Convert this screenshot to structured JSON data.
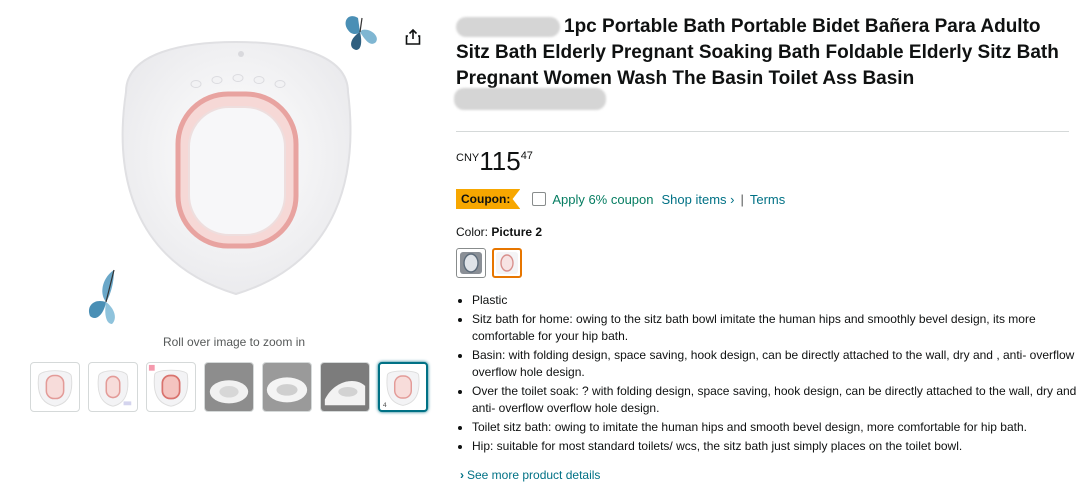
{
  "gallery": {
    "zoom_hint": "Roll over image to zoom in",
    "thumbnails": [
      "white-pink",
      "white-pink-2",
      "white-pink-3",
      "photo-1",
      "photo-2",
      "photo-3",
      "selected"
    ]
  },
  "product": {
    "title": "1pc Portable Bath Portable Bidet Bañera Para Adulto Sitz Bath Elderly Pregnant Soaking Bath Foldable Elderly Sitz Bath Pregnant Women Wash The Basin Toilet Ass Basin",
    "price": {
      "currency": "CNY",
      "whole": "115",
      "fraction": "47"
    },
    "coupon": {
      "badge": "Coupon:",
      "apply": "Apply 6% coupon",
      "shop_items": "Shop items ›",
      "separator": "|",
      "terms": "Terms"
    },
    "color": {
      "label": "Color:",
      "value": "Picture 2"
    },
    "bullets": [
      "Plastic",
      "Sitz bath for home: owing to the sitz bath bowl imitate the human hips and smoothly bevel design, its more comfortable for your hip bath.",
      "Basin: with folding design, space saving, hook design, can be directly attached to the wall, dry and , anti- overflow overflow hole design.",
      "Over the toilet soak: ? with folding design, space saving, hook design, can be directly attached to the wall, dry and , anti- overflow overflow hole design.",
      "Toilet sitz bath: owing to imitate the human hips and smooth bevel design, more comfortable for hip bath.",
      "Hip: suitable for most standard toilets/ wcs, the sitz bath just simply places on the toilet bowl."
    ],
    "see_more": "See more product details"
  },
  "colors": {
    "accent_link": "#007185",
    "coupon": "#f7a700",
    "coupon_text": "#067d62",
    "selected_swatch": "#e77600"
  }
}
